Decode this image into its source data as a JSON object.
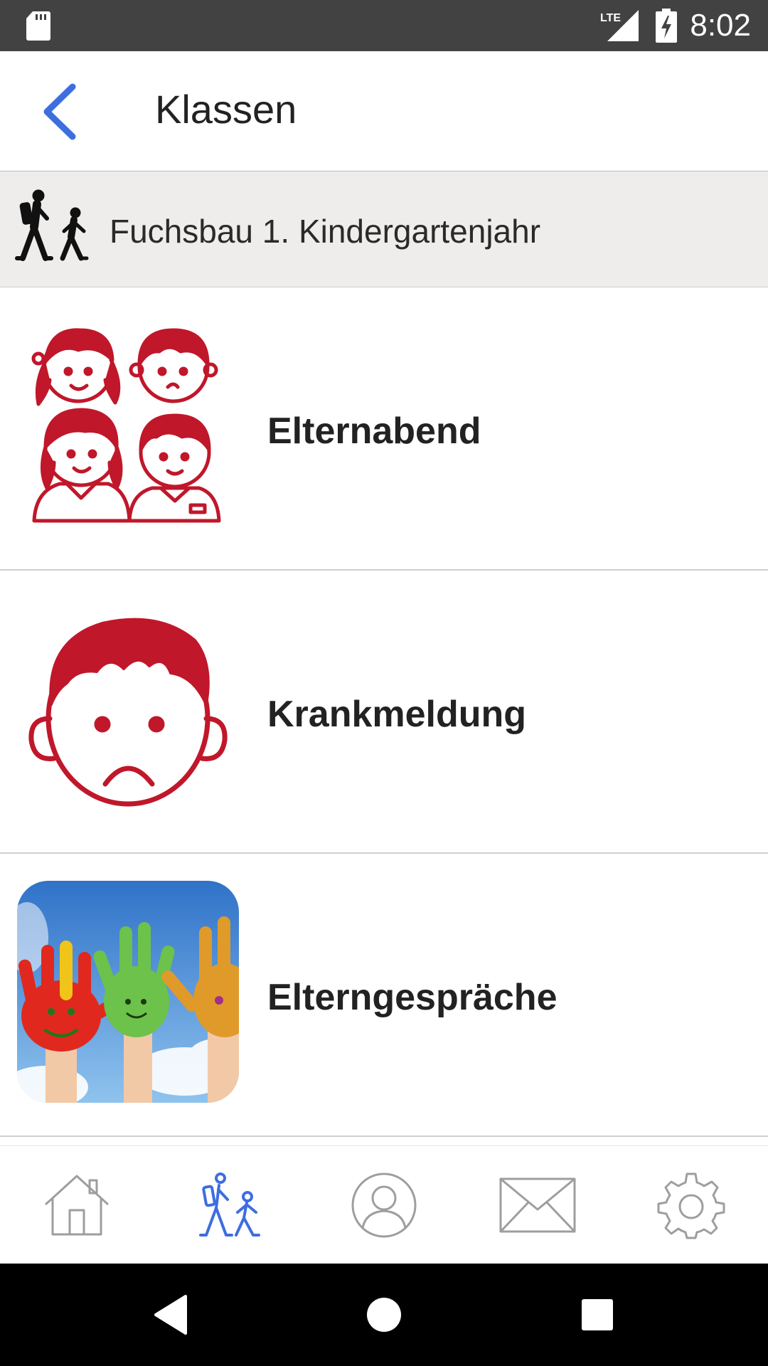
{
  "status_bar": {
    "network_label": "LTE",
    "time": "8:02",
    "icons": [
      "sd-card-icon",
      "lte-signal-icon",
      "battery-charging-icon"
    ]
  },
  "app_bar": {
    "back_icon": "chevron-left-icon",
    "title": "Klassen"
  },
  "class_header": {
    "icon": "walking-people-icon",
    "name": "Fuchsbau 1. Kindergartenjahr"
  },
  "list": {
    "items": [
      {
        "label": "Elternabend",
        "icon": "children-group-icon"
      },
      {
        "label": "Krankmeldung",
        "icon": "sad-child-face-icon"
      },
      {
        "label": "Elterngespräche",
        "icon": "painted-hands-photo"
      }
    ]
  },
  "bottom_nav": {
    "items": [
      {
        "icon": "home-icon",
        "active": false
      },
      {
        "icon": "walking-people-icon",
        "active": true
      },
      {
        "icon": "profile-icon",
        "active": false
      },
      {
        "icon": "mail-icon",
        "active": false
      },
      {
        "icon": "gear-icon",
        "active": false
      }
    ]
  },
  "system_nav": {
    "items": [
      "back-triangle-icon",
      "home-circle-icon",
      "recents-square-icon"
    ]
  },
  "colors": {
    "accent": "#3d6ee0",
    "illustration_red": "#c0172a",
    "header_bg": "#efedeb",
    "status_bar": "#424242",
    "inactive_icon": "#9e9e9e"
  }
}
